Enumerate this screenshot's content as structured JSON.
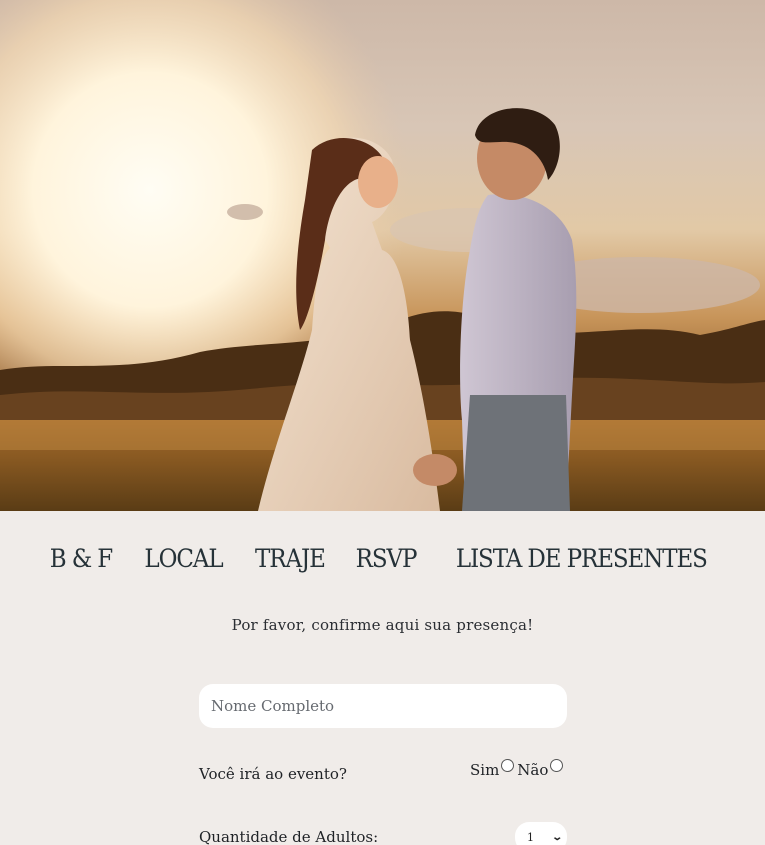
{
  "hero": {
    "image": "couple-sunset-photo"
  },
  "nav": {
    "items": [
      {
        "label": "B & F"
      },
      {
        "label": "LOCAL"
      },
      {
        "label": "TRAJE"
      },
      {
        "label": "RSVP"
      },
      {
        "label": "LISTA DE PRESENTES"
      }
    ]
  },
  "rsvp": {
    "invite_text": "Por favor, confirme aqui sua presença!",
    "name_placeholder": "Nome Completo",
    "name_value": "",
    "attending_question": "Você irá ao evento?",
    "attending_options": [
      {
        "label": "Sim"
      },
      {
        "label": "Não"
      }
    ],
    "adults_label": "Quantidade de Adultos:",
    "adults_value": "1"
  }
}
